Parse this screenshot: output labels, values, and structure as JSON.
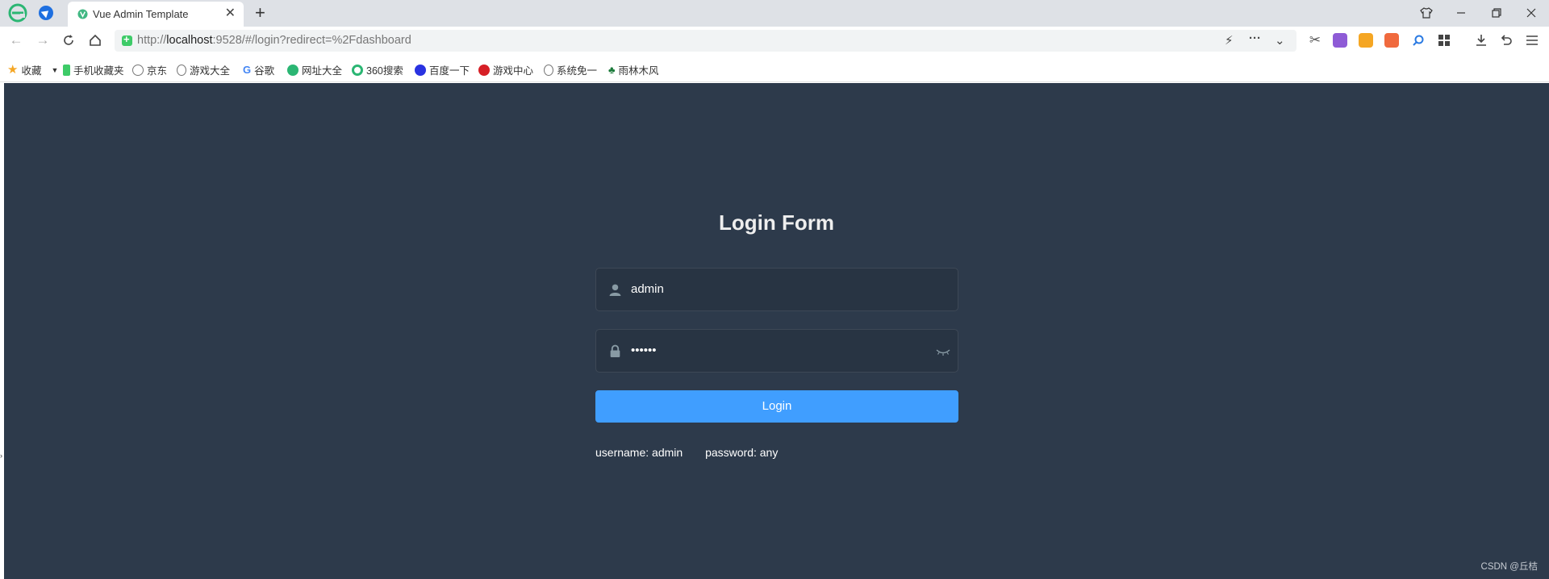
{
  "browser": {
    "tab_title": "Vue Admin Template",
    "tab_close": "✕",
    "new_tab": "+",
    "window_buttons": [
      "shirt-icon",
      "minimize",
      "restore",
      "close"
    ]
  },
  "address_bar": {
    "url_scheme": "http://",
    "url_host": "localhost",
    "url_rest": ":9528/#/login?redirect=%2Fdashboard"
  },
  "bookmarks": [
    {
      "label": "收藏",
      "icon": "star-icon"
    },
    {
      "label": "手机收藏夹",
      "icon": "phone-icon"
    },
    {
      "label": "京东",
      "icon": "globe-icon"
    },
    {
      "label": "游戏大全",
      "icon": "globe-icon"
    },
    {
      "label": "谷歌",
      "icon": "google-icon"
    },
    {
      "label": "网址大全",
      "icon": "site-icon"
    },
    {
      "label": "360搜索",
      "icon": "360-icon"
    },
    {
      "label": "百度一下",
      "icon": "baidu-icon"
    },
    {
      "label": "游戏中心",
      "icon": "game-icon"
    },
    {
      "label": "系统免一",
      "icon": "globe-icon"
    },
    {
      "label": "雨林木风",
      "icon": "tree-icon"
    }
  ],
  "login": {
    "title": "Login Form",
    "username_value": "admin",
    "password_value": "••••••",
    "button_label": "Login",
    "tip_username": "username: admin",
    "tip_password": "password: any"
  },
  "colors": {
    "page_bg": "#2d3a4b",
    "input_bg": "#283443",
    "button": "#409eff"
  },
  "watermark": "CSDN @丘桔"
}
